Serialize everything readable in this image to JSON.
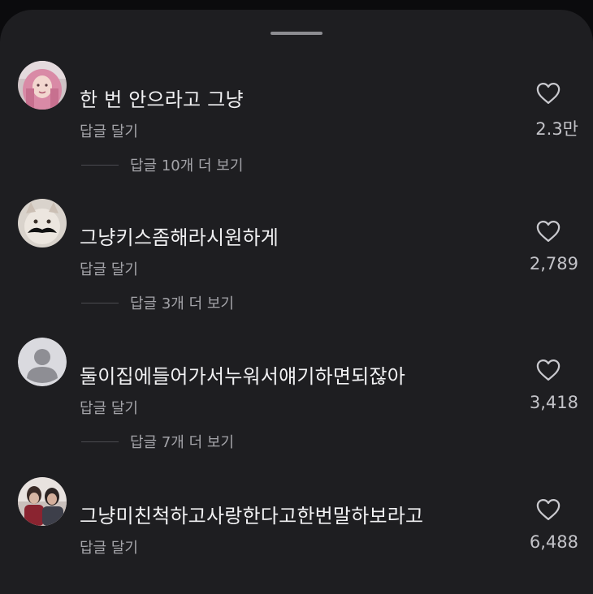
{
  "sheet": {
    "drag_handle": "drag-handle"
  },
  "comments": [
    {
      "text": "한 번 안으라고 그냥",
      "reply_label": "답글 달기",
      "view_replies": "답글 10개 더 보기",
      "likes": "2.3만",
      "avatar": "photo-pink-hair"
    },
    {
      "text": "그냥키스좀해라시원하게",
      "reply_label": "답글 달기",
      "view_replies": "답글 3개 더 보기",
      "likes": "2,789",
      "avatar": "photo-cat-mustache"
    },
    {
      "text": "둘이집에들어가서누워서얘기하면되잖아",
      "reply_label": "답글 달기",
      "view_replies": "답글 7개 더 보기",
      "likes": "3,418",
      "avatar": "default-user-icon"
    },
    {
      "text": "그냥미친척하고사랑한다고한번말하보라고",
      "reply_label": "답글 달기",
      "likes": "6,488",
      "avatar": "photo-two-people"
    }
  ],
  "colors": {
    "sheet_bg": "#1e1e21",
    "text_primary": "#f1f1f3",
    "text_secondary": "#a4a4a9"
  }
}
